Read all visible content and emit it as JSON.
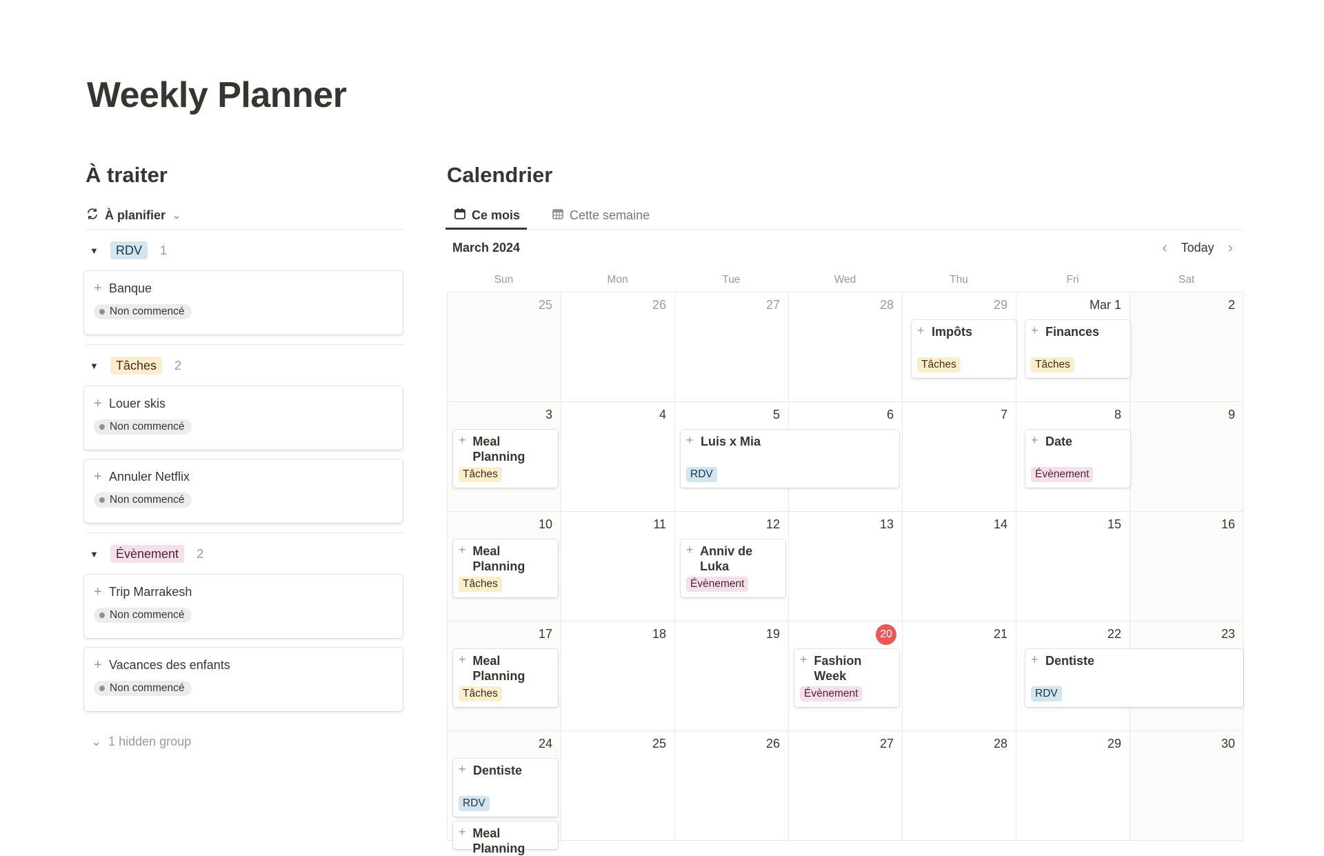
{
  "page": {
    "title": "Weekly Planner"
  },
  "left": {
    "heading": "À traiter",
    "view_label": "À planifier",
    "groups": [
      {
        "name": "RDV",
        "count": "1",
        "items": [
          {
            "title": "Banque",
            "status": "Non commencé"
          }
        ]
      },
      {
        "name": "Tâches",
        "count": "2",
        "items": [
          {
            "title": "Louer skis",
            "status": "Non commencé"
          },
          {
            "title": "Annuler Netflix",
            "status": "Non commencé"
          }
        ]
      },
      {
        "name": "Évènement",
        "count": "2",
        "items": [
          {
            "title": "Trip Marrakesh",
            "status": "Non commencé"
          },
          {
            "title": "Vacances des enfants",
            "status": "Non commencé"
          }
        ]
      }
    ],
    "hidden_groups": "1 hidden group"
  },
  "calendar": {
    "heading": "Calendrier",
    "tabs": [
      {
        "label": "Ce mois",
        "active": true
      },
      {
        "label": "Cette semaine",
        "active": false
      }
    ],
    "month_label": "March 2024",
    "today_label": "Today",
    "weekdays": [
      "Sun",
      "Mon",
      "Tue",
      "Wed",
      "Thu",
      "Fri",
      "Sat"
    ],
    "weeks": [
      [
        "25",
        "26",
        "27",
        "28",
        "29",
        "Mar 1",
        "2"
      ],
      [
        "3",
        "4",
        "5",
        "6",
        "7",
        "8",
        "9"
      ],
      [
        "10",
        "11",
        "12",
        "13",
        "14",
        "15",
        "16"
      ],
      [
        "17",
        "18",
        "19",
        "20",
        "21",
        "22",
        "23"
      ],
      [
        "24",
        "25",
        "26",
        "27",
        "28",
        "29",
        "30"
      ]
    ],
    "today_date": "20",
    "events": [
      {
        "title": "Impôts",
        "tag": "Tâches",
        "color": "yellow"
      },
      {
        "title": "Finances",
        "tag": "Tâches",
        "color": "yellow"
      },
      {
        "title": "Meal Planning",
        "tag": "Tâches",
        "color": "yellow"
      },
      {
        "title": "Luis x Mia",
        "tag": "RDV",
        "color": "blue"
      },
      {
        "title": "Date",
        "tag": "Évènement",
        "color": "pink"
      },
      {
        "title": "Meal Planning",
        "tag": "Tâches",
        "color": "yellow"
      },
      {
        "title": "Anniv de Luka",
        "tag": "Évènement",
        "color": "pink"
      },
      {
        "title": "Meal Planning",
        "tag": "Tâches",
        "color": "yellow"
      },
      {
        "title": "Fashion Week",
        "tag": "Évènement",
        "color": "pink"
      },
      {
        "title": "Dentiste",
        "tag": "RDV",
        "color": "blue"
      },
      {
        "title": "Dentiste",
        "tag": "RDV",
        "color": "blue"
      },
      {
        "title": "Meal Planning",
        "tag": "",
        "color": "yellow"
      }
    ],
    "tag_colors": {
      "blue": "#d3e5ef",
      "yellow": "#fbeecd",
      "pink": "#f5e0e9"
    }
  }
}
